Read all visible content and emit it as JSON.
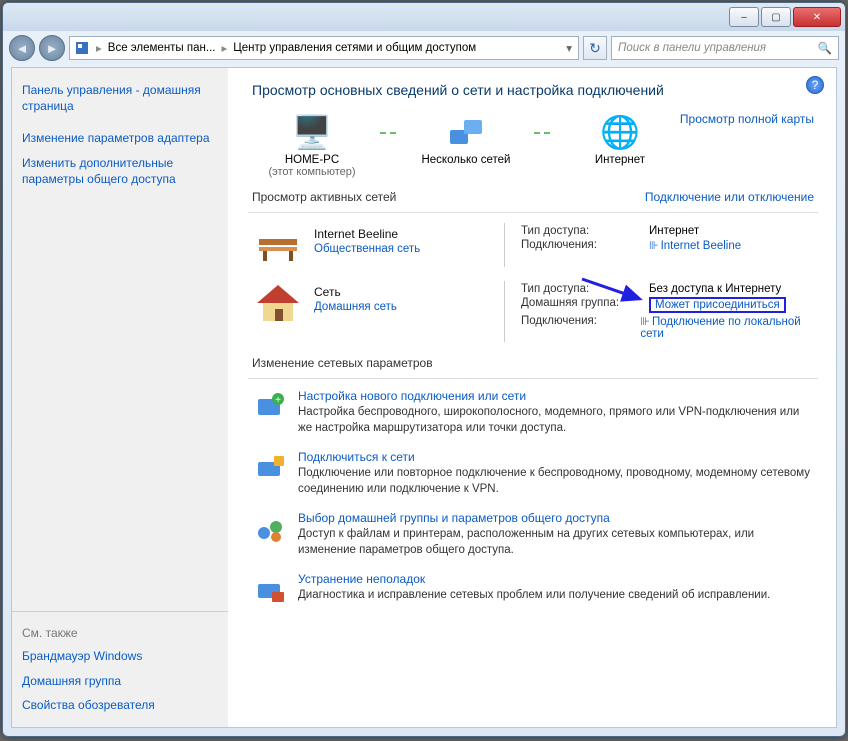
{
  "breadcrumb": {
    "part1": "Все элементы пан...",
    "part2": "Центр управления сетями и общим доступом"
  },
  "search": {
    "placeholder": "Поиск в панели управления"
  },
  "sidebar": {
    "home": "Панель управления - домашняя страница",
    "links": [
      "Изменение параметров адаптера",
      "Изменить дополнительные параметры общего доступа"
    ],
    "seeAlso": "См. также",
    "bottomLinks": [
      "Брандмауэр Windows",
      "Домашняя группа",
      "Свойства обозревателя"
    ]
  },
  "main": {
    "heading": "Просмотр основных сведений о сети и настройка подключений",
    "fullMap": "Просмотр полной карты",
    "map": {
      "pc": "HOME-PC",
      "pcSub": "(этот компьютер)",
      "multi": "Несколько сетей",
      "internet": "Интернет"
    },
    "activeHead": "Просмотр активных сетей",
    "connDisconn": "Подключение или отключение",
    "nets": [
      {
        "name": "Internet Beeline",
        "type": "Общественная сеть",
        "props": {
          "accessLabel": "Тип доступа:",
          "accessValue": "Интернет",
          "connLabel": "Подключения:",
          "connLink": "Internet Beeline"
        }
      },
      {
        "name": "Сеть",
        "type": "Домашняя сеть",
        "props": {
          "accessLabel": "Тип доступа:",
          "accessValue": "Без доступа к Интернету",
          "homegroupLabel": "Домашняя группа:",
          "homegroupLink": "Может присоединиться",
          "connLabel": "Подключения:",
          "connLink": "Подключение по локальной сети"
        }
      }
    ],
    "settingsHead": "Изменение сетевых параметров",
    "settings": [
      {
        "title": "Настройка нового подключения или сети",
        "desc": "Настройка беспроводного, широкополосного, модемного, прямого или VPN-подключения или же настройка маршрутизатора или точки доступа."
      },
      {
        "title": "Подключиться к сети",
        "desc": "Подключение или повторное подключение к беспроводному, проводному, модемному сетевому соединению или подключение к VPN."
      },
      {
        "title": "Выбор домашней группы и параметров общего доступа",
        "desc": "Доступ к файлам и принтерам, расположенным на других сетевых компьютерах, или изменение параметров общего доступа."
      },
      {
        "title": "Устранение неполадок",
        "desc": "Диагностика и исправление сетевых проблем или получение сведений об исправлении."
      }
    ]
  }
}
